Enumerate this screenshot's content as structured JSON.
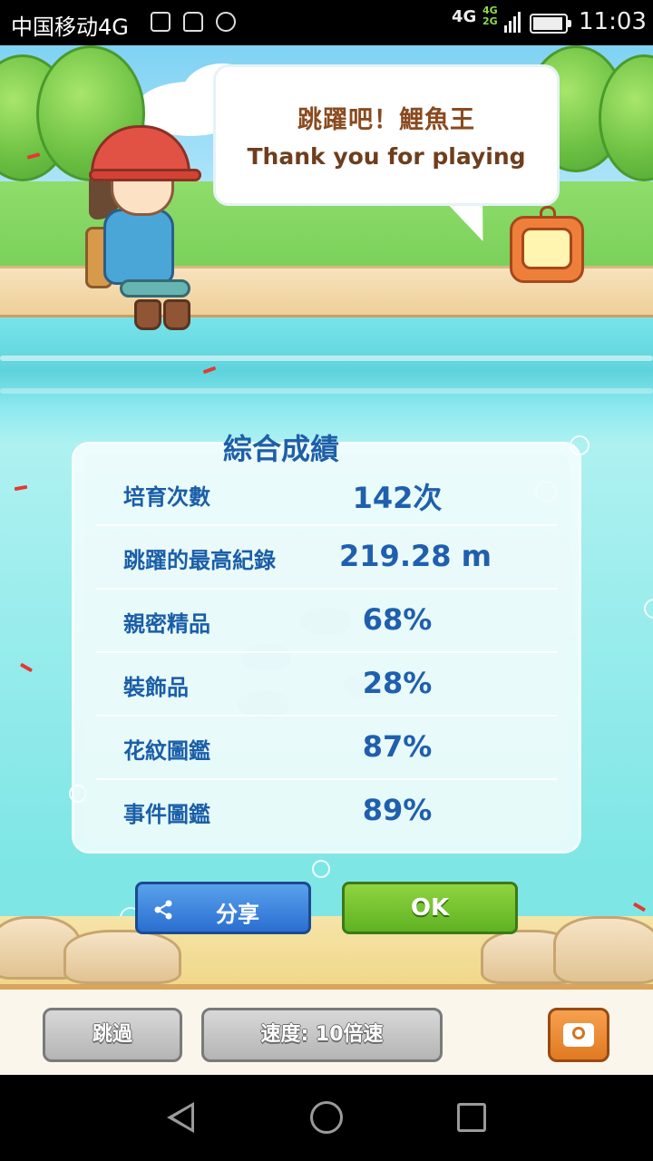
{
  "status_bar": {
    "carrier": "中国移动4G",
    "network": "4G",
    "network_small_top": "4G",
    "network_small_bottom": "2G",
    "time": "11:03",
    "battery_level": 0.95
  },
  "speech_bubble": {
    "title": "跳躍吧！鯉魚王",
    "subtitle": "Thank you for playing"
  },
  "results": {
    "title": "綜合成績",
    "rows": [
      {
        "label": "培育次數",
        "value": "142次"
      },
      {
        "label": "跳躍的最高紀錄",
        "value": "219.28 m"
      },
      {
        "label": "親密精品",
        "value": "68%"
      },
      {
        "label": "裝飾品",
        "value": "28%"
      },
      {
        "label": "花紋圖鑑",
        "value": "87%"
      },
      {
        "label": "事件圖鑑",
        "value": "89%"
      }
    ]
  },
  "buttons": {
    "share_label": "分享",
    "ok_label": "OK",
    "skip_label": "跳過",
    "speed_label": "速度: 10倍速"
  },
  "icons": {
    "share": "share-icon",
    "camera": "camera-icon",
    "nav_back": "back-triangle-icon",
    "nav_home": "home-circle-icon",
    "nav_recent": "recent-square-icon"
  },
  "colors": {
    "title_blue": "#1e5fa8",
    "share_blue": "#2a6fd0",
    "ok_green": "#5fb223",
    "camera_orange": "#e07a22"
  }
}
